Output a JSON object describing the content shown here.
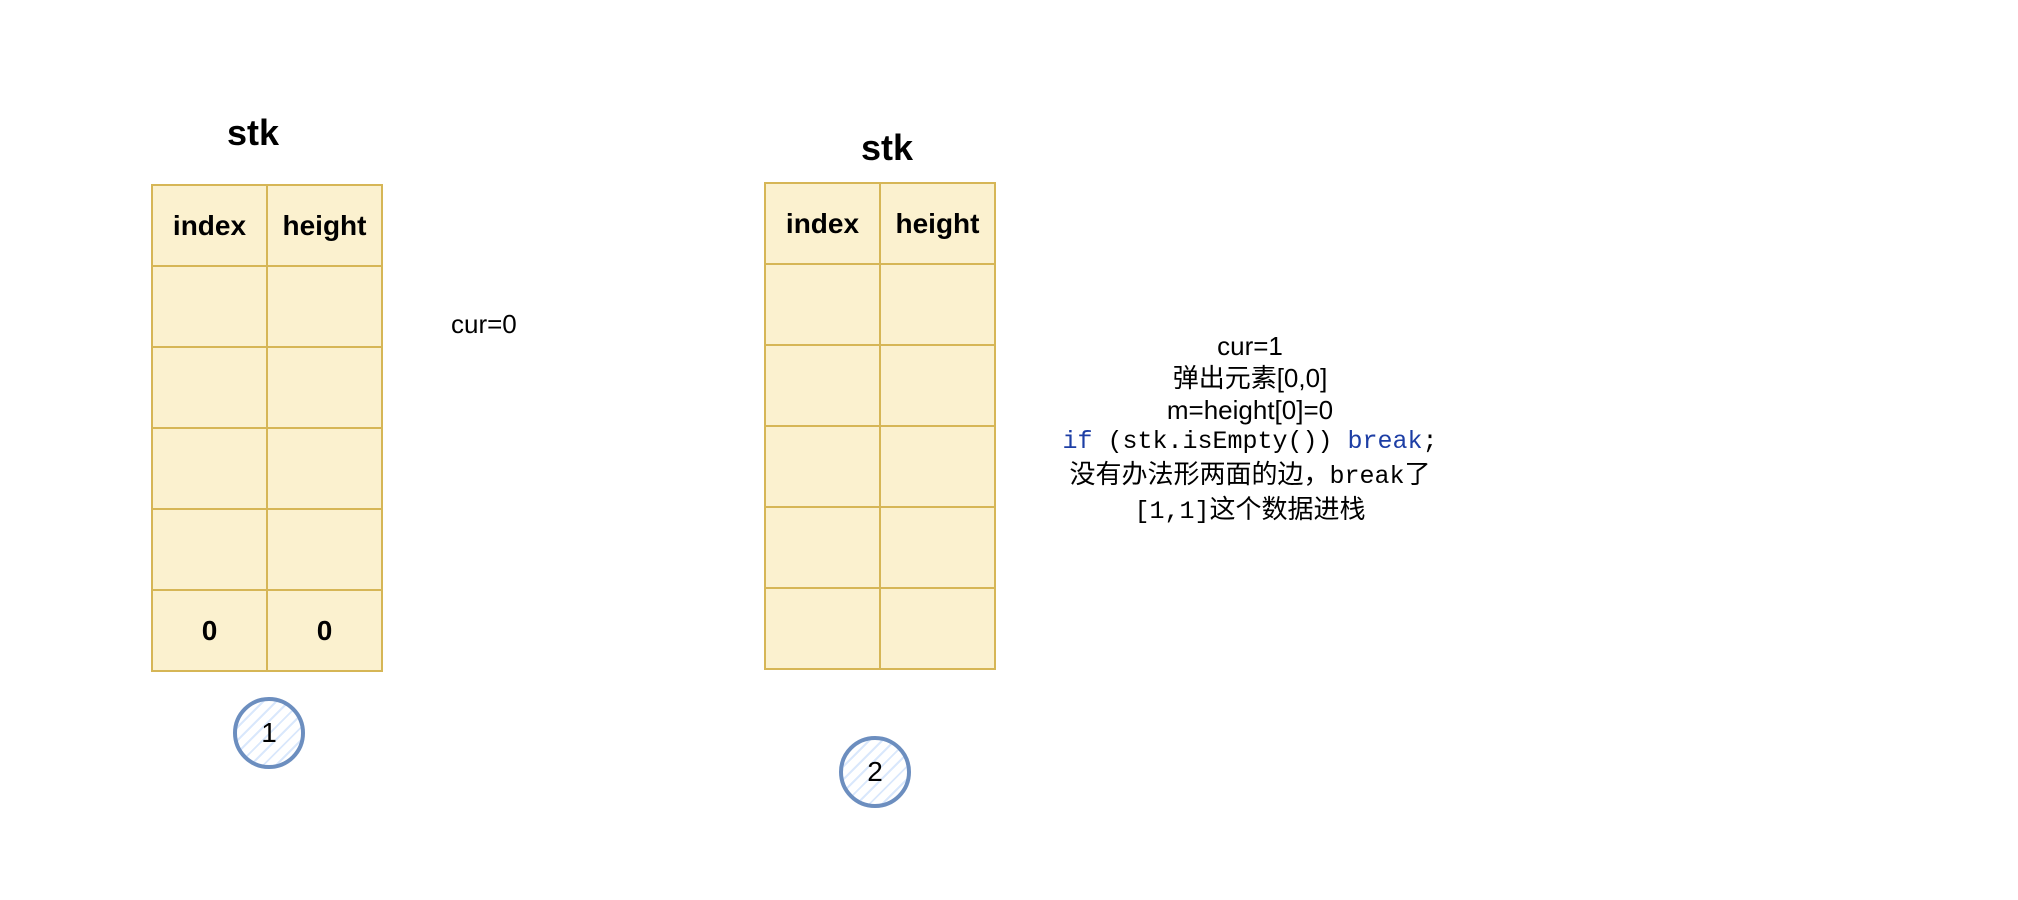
{
  "panels": [
    {
      "stack_title": "stk",
      "header": [
        "index",
        "height"
      ],
      "rows": [
        [
          "",
          ""
        ],
        [
          "",
          ""
        ],
        [
          "",
          ""
        ],
        [
          "",
          ""
        ],
        [
          "0",
          "0"
        ]
      ],
      "step": "1",
      "note": "cur=0"
    },
    {
      "stack_title": "stk",
      "header": [
        "index",
        "height"
      ],
      "rows": [
        [
          "",
          ""
        ],
        [
          "",
          ""
        ],
        [
          "",
          ""
        ],
        [
          "",
          ""
        ],
        [
          "",
          ""
        ]
      ],
      "step": "2",
      "note_lines": {
        "l1": "cur=1",
        "l2": "弹出元素[0,0]",
        "l3": "m=height[0]=0",
        "l4_if": "if",
        "l4_mid": " (stk.isEmpty()) ",
        "l4_break": "break",
        "l4_end": ";",
        "l5_a": "没有办法形两面的边，",
        "l5_code": "break",
        "l5_b": "了",
        "l6_code": "[1,1]",
        "l6_b": "这个数据进栈"
      }
    }
  ]
}
